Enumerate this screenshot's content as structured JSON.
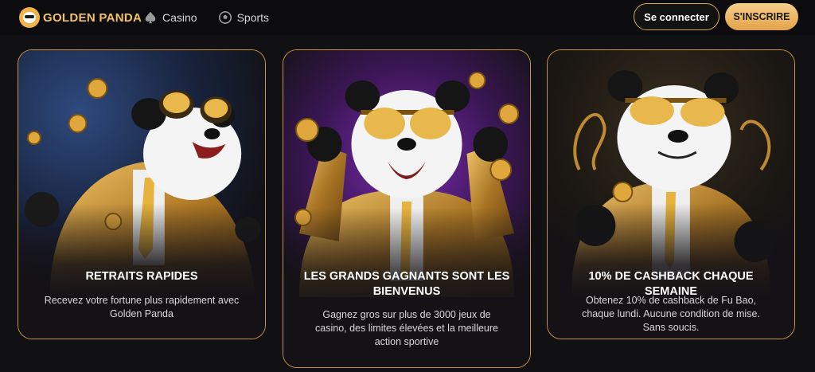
{
  "brand": {
    "name": "GOLDEN PANDA"
  },
  "nav": [
    {
      "label": "Casino",
      "icon": "spade-icon"
    },
    {
      "label": "Sports",
      "icon": "soccer-ball-icon"
    }
  ],
  "auth": {
    "login_label": "Se connecter",
    "signup_label": "S'INSCRIRE"
  },
  "colors": {
    "accent": "#e3a24a",
    "card_border": "#c89143",
    "background": "#111013"
  },
  "cards": [
    {
      "title": "RETRAITS RAPIDES",
      "text": "Recevez votre fortune plus rapidement avec Golden Panda",
      "image": "panda-running-with-coins"
    },
    {
      "title": "LES GRANDS GAGNANTS SONT LES BIENVENUS",
      "text": "Gagnez gros sur plus de 3000 jeux de casino, des limites élevées et la meilleure action sportive",
      "image": "panda-cheering-with-coins"
    },
    {
      "title": "10% DE CASHBACK CHAQUE SEMAINE",
      "text": "Obtenez 10% de cashback de Fu Bao, chaque lundi. Aucune condition de mise. Sans soucis.",
      "image": "panda-flipping-coin"
    }
  ]
}
